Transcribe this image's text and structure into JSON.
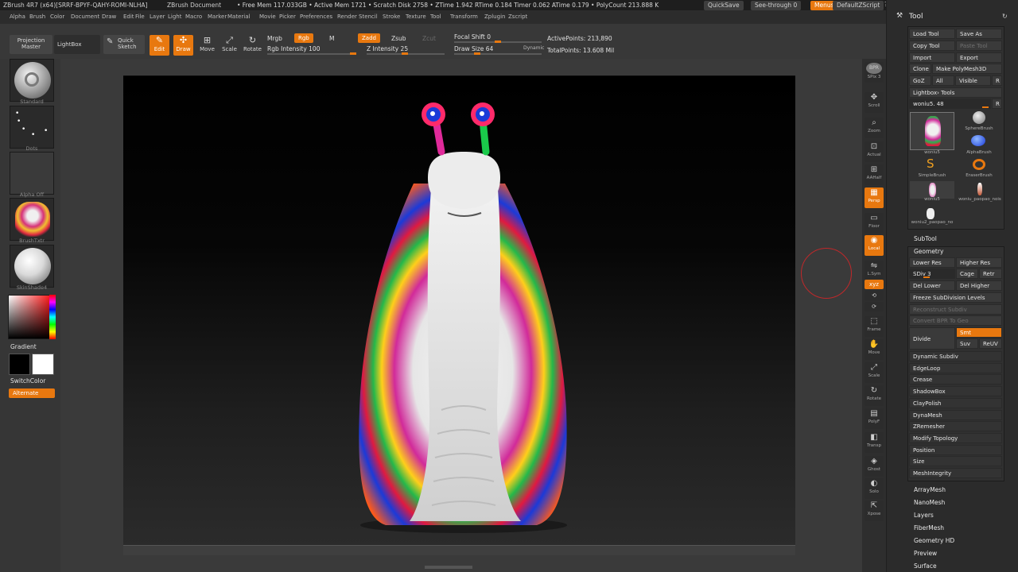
{
  "titlebar": {
    "app": "ZBrush 4R7 (x64)[SRRF-BPYF-QAHY-ROMI-NLHA]",
    "document": "ZBrush Document",
    "stats": "• Free Mem 117.033GB • Active Mem 1721 • Scratch Disk 2758 • ZTime 1.942 RTime 0.184 Timer 0.062 ATime 0.179 • PolyCount 213.888 K",
    "quicksave": "QuickSave",
    "see_through": "See-through  0",
    "menus": "Menus",
    "script": "DefaultZScript"
  },
  "menubar": [
    "Alpha",
    "Brush",
    "Color",
    "Document",
    "Draw",
    "Edit",
    "File",
    "Layer",
    "Light",
    "Macro",
    "Marker",
    "Material",
    "Movie",
    "Picker",
    "Preferences",
    "Render",
    "Stencil",
    "Stroke",
    "Texture",
    "Tool",
    "Transform",
    "Zplugin",
    "Zscript"
  ],
  "toolbar": {
    "projection_master": "Projection Master",
    "lightbox": "LightBox",
    "quick_sketch": "Quick Sketch",
    "edit": "Edit",
    "draw": "Draw",
    "move": "Move",
    "scale": "Scale",
    "rotate": "Rotate",
    "mrgb": "Mrgb",
    "rgb": "Rgb",
    "m": "M",
    "zadd": "Zadd",
    "zsub": "Zsub",
    "zcut": "Zcut",
    "rgb_intensity": "Rgb Intensity 100",
    "z_intensity": "Z Intensity 25",
    "focal_shift": "Focal Shift 0",
    "draw_size": "Draw Size 64",
    "dynamic": "Dynamic",
    "active_points": "ActivePoints: 213,890",
    "total_points": "TotalPoints: 13.608 Mil"
  },
  "left": {
    "tiles": [
      "Standard",
      "Dots",
      "Alpha Off",
      "BrushTxtr",
      "SkinShade4"
    ],
    "gradient": "Gradient",
    "switch_color": "SwitchColor",
    "alternate": "Alternate"
  },
  "rightbar": [
    {
      "icon": "BPR",
      "label": "SPix 3"
    },
    {
      "icon": "✥",
      "label": "Scroll"
    },
    {
      "icon": "⌕",
      "label": "Zoom"
    },
    {
      "icon": "⊡",
      "label": "Actual"
    },
    {
      "icon": "⊞",
      "label": "AAHalf"
    },
    {
      "icon": "▦",
      "label": "Persp"
    },
    {
      "icon": "▭",
      "label": "Floor"
    },
    {
      "icon": "◉",
      "label": "Local"
    },
    {
      "icon": "⇋",
      "label": "L.Sym"
    },
    {
      "icon": "xyz",
      "label": ""
    },
    {
      "icon": "⟲",
      "label": ""
    },
    {
      "icon": "⟳",
      "label": ""
    },
    {
      "icon": "⬚",
      "label": "Frame"
    },
    {
      "icon": "✋",
      "label": "Move"
    },
    {
      "icon": "⤢",
      "label": "Scale"
    },
    {
      "icon": "↻",
      "label": "Rotate"
    },
    {
      "icon": "▤",
      "label": "PolyF"
    },
    {
      "icon": "◧",
      "label": "Transp"
    },
    {
      "icon": "◈",
      "label": "Ghost"
    },
    {
      "icon": "◐",
      "label": "Solo"
    },
    {
      "icon": "⇱",
      "label": "Xpose"
    }
  ],
  "tool": {
    "title": "Tool",
    "load_tool": "Load Tool",
    "save_as": "Save As",
    "copy_tool": "Copy Tool",
    "paste_tool": "Paste Tool",
    "import": "Import",
    "export": "Export",
    "clone": "Clone",
    "make_polymesh": "Make PolyMesh3D",
    "goz": "GoZ",
    "all": "All",
    "visible": "Visible",
    "r": "R",
    "lightbox_tools": "Lightbox› Tools",
    "current_tool": "woniu5. 48",
    "thumbs": [
      "woniu5",
      "SphereBrush",
      "AlphaBrush",
      "SimpleBrush",
      "EraserBrush",
      "woniu5",
      "woniu_paopao_nois",
      "woniu2_paopao_no"
    ],
    "subtool": "SubTool",
    "geometry": "Geometry",
    "lower_res": "Lower Res",
    "higher_res": "Higher Res",
    "sdiv": "SDiv 3",
    "cage": "Cage",
    "retr": "Retr",
    "del_lower": "Del Lower",
    "del_higher": "Del Higher",
    "freeze": "Freeze SubDivision Levels",
    "reconstruct": "Reconstruct Subdiv",
    "convert_bpr": "Convert BPR To Geo",
    "divide": "Divide",
    "smt": "Smt",
    "suv": "Suv",
    "reuv": "ReUV",
    "geometry_items": [
      "Dynamic Subdiv",
      "EdgeLoop",
      "Crease",
      "ShadowBox",
      "ClayPolish",
      "DynaMesh",
      "ZRemesher",
      "Modify Topology",
      "Position",
      "Size",
      "MeshIntegrity"
    ],
    "sections": [
      "ArrayMesh",
      "NanoMesh",
      "Layers",
      "FiberMesh",
      "Geometry HD",
      "Preview",
      "Surface"
    ]
  },
  "colors": {
    "accent": "#e8780f",
    "bg": "#3a3a3a",
    "canvas": "#000000"
  }
}
